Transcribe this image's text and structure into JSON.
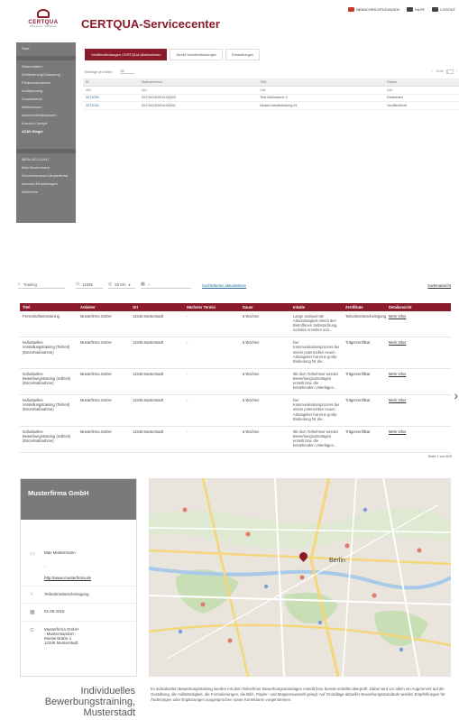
{
  "servicecenter": {
    "topbar": {
      "notifications": "BENACHRICHTIGUNGEN",
      "help": "HILFE",
      "logout": "LOGOUT"
    },
    "logo": {
      "name": "CERTQUA",
      "tagline": "Bildungszert · Qualitätszert"
    },
    "title": "CERTQUA-Servicecenter",
    "sidebar": {
      "section_label": "Start",
      "items": [
        "Stammdaten",
        "Zertifizierung/Zulassung",
        "Fördermaßnahme",
        "Auditplanung",
        "Zusatzdienst",
        "Maßnahmen",
        "Anbieter/Maßnahmen",
        "Kunden-Cockpit",
        "AZAV-Siegel"
      ],
      "account_label": "MEIN ACCOUNT",
      "account_items": [
        "Max Mustermann",
        "Servicebenutzer Musterfirma",
        "Account-Einstellungen",
        "Abmelden"
      ]
    },
    "tabs": [
      "Veröffentlichungen CERTQUA-Maßnahmen",
      "Direkt-Veröffentlichungen",
      "Einstellungen"
    ],
    "controls": {
      "per_page_label": "Einträge pro Seite:",
      "per_page_value": "50",
      "page_label": "Seite",
      "page_value": "1"
    },
    "columns": [
      "ID",
      "Maßnahmeno",
      "Titel",
      "Status"
    ],
    "filter_row": [
      "Alle",
      "Alle",
      "Alle",
      "Alle"
    ],
    "rows": [
      [
        "3272039",
        "2017M10039141/000Z",
        "Test Maßnahme 2",
        "Deaktiviert"
      ],
      [
        "3272040",
        "2017M10039141/0001",
        "Muster-Weiterbildung #1",
        "Veröffentlicht"
      ]
    ]
  },
  "search": {
    "query": "Training",
    "zip": "12345",
    "radius": "50 Km",
    "date": "–",
    "update_link": "Suchkriterien aktualisieren",
    "map_link": "Kartenansicht",
    "columns": [
      "Titel",
      "Anbieter",
      "Ort",
      "Nächster Termin",
      "Dauer",
      "Inhalte",
      "Zertifikate",
      "Detailansicht"
    ],
    "rows": [
      {
        "title": "Persönlichkeitstraining",
        "provider": "Musterfirma GmbH",
        "place": "12345 Musterstadt",
        "next": "-",
        "duration": "6 Wochen",
        "content": "Lange andauernde Arbeitslosigkeit nimmt den Betroffenen Selbstachtung, soziales Ansehen und...",
        "certificate": "Teilnahmebescheinigung",
        "link": "Mehr Infos"
      },
      {
        "title": "Individuelles Vorstellungstraining (Teilzeit) (Einzelmaßnahme)",
        "provider": "Musterfirma GmbH",
        "place": "12345 Musterstadt",
        "next": "-",
        "duration": "6 Wochen",
        "content": "Der Kommunikationsprozess bei einem potenziellen neuen Arbeitgeber hat eine große Bedeutung für die...",
        "certificate": "Trägerzertifikat",
        "link": "Mehr Infos"
      },
      {
        "title": "Individuelles Bewerbungstraining (Vollzeit) (Einzelmaßnahme)",
        "provider": "Musterfirma GmbH",
        "place": "12345 Musterstadt",
        "next": "-",
        "duration": "6 Wochen",
        "content": "Mit dem Teilnehmer werden Bewerbungsunterlagen erstellt bzw. die bestehenden Unterlagen...",
        "certificate": "Trägerzertifikat",
        "link": "Mehr Infos"
      },
      {
        "title": "Individuelles Vorstellungstraining (Teilzeit) (Einzelmaßnahme)",
        "provider": "Musterfirma GmbH",
        "place": "12345 Musterstadt",
        "next": "-",
        "duration": "6 Wochen",
        "content": "Der Kommunikationsprozess bei einem potenziellen neuen Arbeitgeber hat eine große Bedeutung für die...",
        "certificate": "Trägerzertifikat",
        "link": "Mehr Infos"
      },
      {
        "title": "Individuelles Bewerbungstraining (Vollzeit) (Einzelmaßnahme)",
        "provider": "Musterfirma GmbH",
        "place": "12345 Musterstadt",
        "next": "-",
        "duration": "6 Wochen",
        "content": "Mit dem Teilnehmer werden Bewerbungsunterlagen erstellt bzw. die bestehenden Unterlagen...",
        "certificate": "Trägerzertifikat",
        "link": "Mehr Infos"
      }
    ],
    "page_info": "Seite 1 von 843"
  },
  "detail": {
    "company": "Musterfirma GmbH",
    "contact": "Max Mustermann",
    "phone": "-",
    "website": "http://www.musterfirma.de",
    "certificate": "Teilnahmebescheinigung",
    "date": "01.09.2018",
    "address_lines": [
      "Musterfirma GmbH",
      "- Musterstandort -",
      "Musterstraße 1",
      "12345 Musterstadt"
    ],
    "map_label": "Berlin",
    "title": "Individuelles Bewerbungstraining, Musterstadt",
    "description": "Im individuellen Bewerbungstraining werden mit dem Teilnehmer Bewerbungsunterlagen erstellt bzw. bereits erstellte überprüft. Dabei wird vor allem ein Augenmerk auf die Gestaltung, die Vollständigkeit, die Formulierungen, die Bild-, Papier- und Mappenauswahl gelegt. Auf Grundlage aktueller Bewerbungsstandards werden Empfehlungen für Änderungen oder Ergänzungen ausgesprochen sowie Korrekturen vorgenommen."
  },
  "colors": {
    "brand": "#8b1a2b",
    "sidebar": "#7a7a7a",
    "link": "#2b6cb0"
  }
}
